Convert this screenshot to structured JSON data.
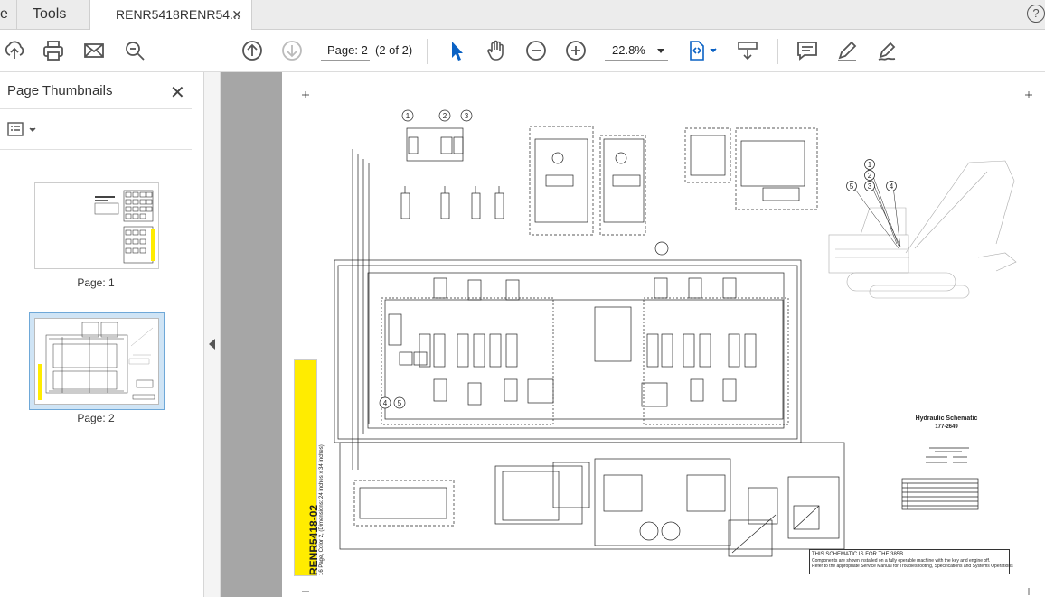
{
  "tabs": {
    "home_partial": "e",
    "tools": "Tools",
    "document": "RENR5418RENR54...",
    "close_glyph": "✕",
    "help_glyph": "?"
  },
  "toolbar": {
    "page_field": "Page: 2",
    "page_of": "(2 of 2)",
    "zoom": "22.8%",
    "icons": [
      "upload-icon",
      "print-icon",
      "email-icon",
      "search-icon",
      "prev-page-icon",
      "next-page-icon",
      "select-cursor-icon",
      "hand-icon",
      "zoom-out-icon",
      "zoom-in-icon",
      "fit-page-icon",
      "scroll-mode-icon",
      "comment-icon",
      "highlight-pen-icon",
      "sign-icon"
    ]
  },
  "sidebar": {
    "title": "Page Thumbnails",
    "close_glyph": "✕",
    "thumbnails": [
      {
        "label": "Page: 1"
      },
      {
        "label": "Page: 2"
      }
    ]
  },
  "document": {
    "side_title": "RENR5418-02",
    "side_subtitle": "16 Page, Color 2, (Dimensions: 24 inches x 34 inches)",
    "schematic_title": "Hydraulic Schematic",
    "schematic_number": "177-2649",
    "note_line1": "THIS SCHEMATIC IS FOR THE 385B",
    "note_line2": "Components are shown installed on a fully operable machine with the key and engine off.",
    "note_line3": "Refer to the appropriate Service Manual for Troubleshooting, Specifications and Systems Operations",
    "callouts_top": [
      "1",
      "2",
      "3"
    ],
    "callouts_machine": [
      "1",
      "2",
      "3",
      "4",
      "5"
    ],
    "callouts_left": [
      "4",
      "5"
    ]
  },
  "colors": {
    "accent": "#0b62c4",
    "selected_thumb": "#cfe4f5",
    "canvas": "#a6a6a6",
    "yellow_strip": "#ffec00"
  }
}
